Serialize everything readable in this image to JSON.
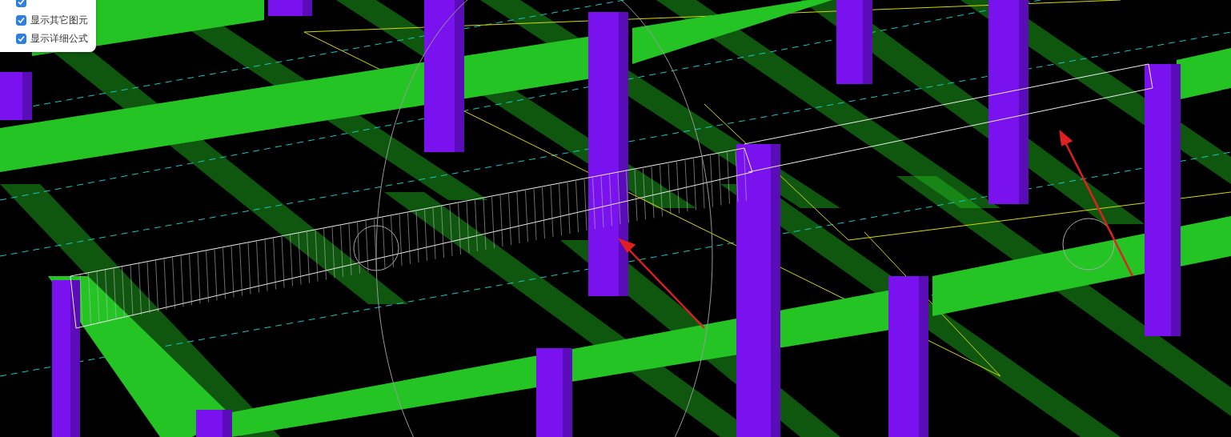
{
  "viewport": {
    "kind": "model-3d"
  },
  "options": [
    {
      "checked": true
    },
    {
      "label": "显示其它图元",
      "checked": true
    },
    {
      "label": "显示详细公式",
      "checked": true
    }
  ]
}
